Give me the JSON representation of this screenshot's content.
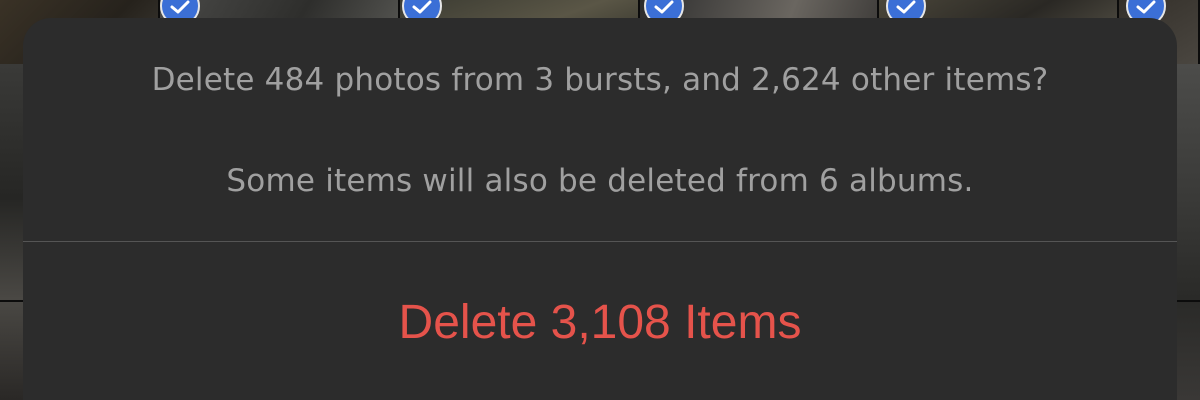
{
  "background": {
    "selected_icon": "checkmark-circle-icon",
    "selected_count_visible": 5
  },
  "alert": {
    "title": "Delete 484 photos from 3 bursts, and 2,624 other items?",
    "message": "Some items will also be deleted from 6 albums.",
    "actions": [
      {
        "label": "Delete 3,108 Items",
        "style": "destructive"
      }
    ]
  },
  "colors": {
    "sheet_background": "#2c2c2c",
    "secondary_text": "#a0a0a0",
    "destructive": "#e5534b",
    "selection_badge": "#3b6fd6"
  }
}
